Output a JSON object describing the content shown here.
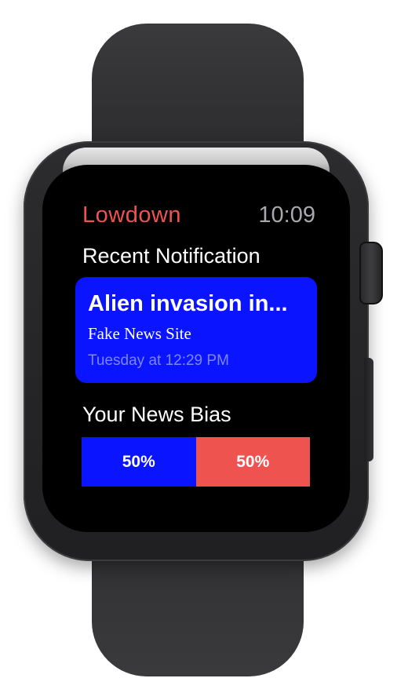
{
  "app": {
    "title": "Lowdown",
    "time": "10:09"
  },
  "recent": {
    "heading": "Recent Notification",
    "notification": {
      "title": "Alien invasion in...",
      "source": "Fake News Site",
      "timestamp": "Tuesday at 12:29 PM"
    }
  },
  "bias": {
    "heading": "Your News Bias",
    "left": {
      "percent": 0.5,
      "label": "50%"
    },
    "right": {
      "percent": 0.5,
      "label": "50%"
    }
  },
  "colors": {
    "accent_red": "#ef5350",
    "bias_blue": "#0a14ff",
    "clock_gray": "#a9a9ad",
    "timestamp_blue": "#7f87ff",
    "device_band": "#333335",
    "screen_bg": "#000000"
  },
  "icons": {
    "digital_crown": "digital-crown-icon",
    "side_button": "side-button-icon"
  }
}
